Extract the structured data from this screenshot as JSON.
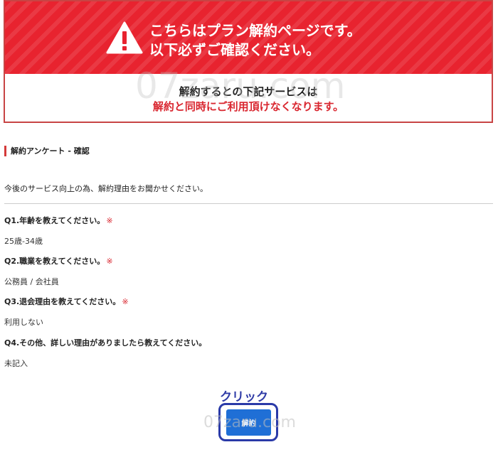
{
  "warning": {
    "title_line1": "こちらはプラン解約ページです。",
    "title_line2": "以下必ずご確認ください。",
    "message_line1": "解約するとの下記サービスは",
    "message_line2": "解約と同時にご利用頂けなくなります。"
  },
  "watermark": {
    "text": "07zaru.com"
  },
  "survey": {
    "section_title": "解約アンケート - 確認",
    "intro": "今後のサービス向上の為、解約理由をお聞かせください。",
    "questions": [
      {
        "label": "Q1.年齢を教えてください。",
        "required_mark": "※",
        "answer": "25歳-34歳"
      },
      {
        "label": "Q2.職業を教えてください。",
        "required_mark": "※",
        "answer": "公務員 / 会社員"
      },
      {
        "label": "Q3.退会理由を教えてください。",
        "required_mark": "※",
        "answer": "利用しない"
      },
      {
        "label": "Q4.その他、詳しい理由がありましたら教えてください。",
        "answer": "未記入"
      }
    ]
  },
  "annotation": {
    "click_label": "クリック"
  },
  "actions": {
    "cancel_button_label": "解約"
  },
  "colors": {
    "warning_red": "#e8232f",
    "button_blue": "#1f6fd6",
    "annotation_blue": "#2a3aa8"
  }
}
